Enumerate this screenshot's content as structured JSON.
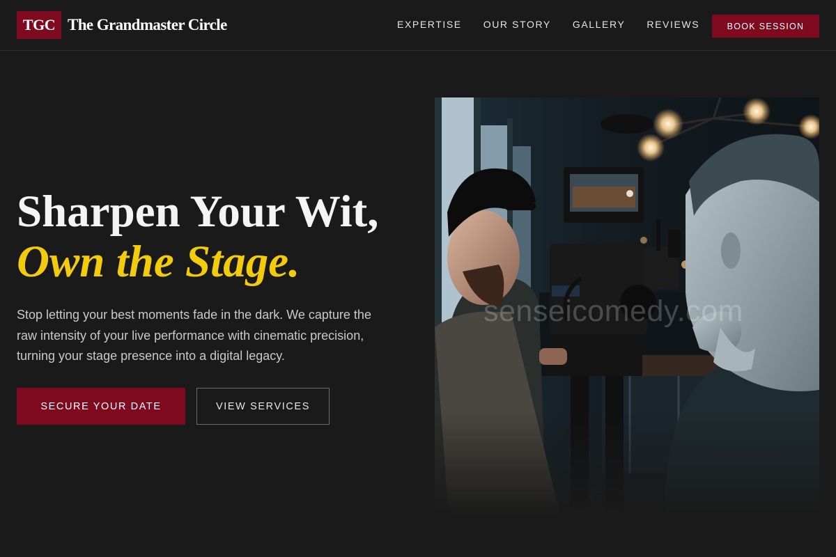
{
  "header": {
    "logo_badge": "TGC",
    "logo_text": "The Grandmaster Circle",
    "nav": [
      "EXPERTISE",
      "OUR STORY",
      "GALLERY",
      "REVIEWS"
    ],
    "book_label": "BOOK SESSION"
  },
  "hero": {
    "headline_line1": "Sharpen Your Wit,",
    "headline_line2": "Own the Stage.",
    "subtext": "Stop letting your best moments fade in the dark. We capture the raw intensity of your live performance with cinematic precision, turning your stage presence into a digital legacy.",
    "primary_button": "SECURE YOUR DATE",
    "secondary_button": "VIEW SERVICES"
  },
  "photo": {
    "watermark": "senseicomedy.com"
  },
  "colors": {
    "accent": "#7f0a1f",
    "highlight": "#f2cc0c",
    "background": "#1a1a1a"
  }
}
